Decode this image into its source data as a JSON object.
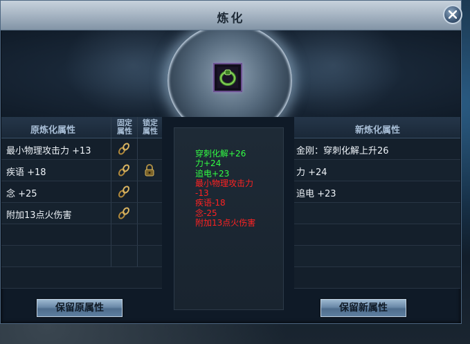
{
  "window": {
    "title": "炼化",
    "close_icon": "close-icon",
    "item_icon": "green-ring-icon"
  },
  "left_panel": {
    "header": "原炼化属性",
    "col_fixed": "固定\n属性",
    "col_fixed_l1": "固定",
    "col_fixed_l2": "属性",
    "col_lock_l1": "锁定",
    "col_lock_l2": "属性",
    "rows": [
      {
        "text": "最小物理攻击力 +13",
        "fixed_icon": "chain-icon",
        "lock_icon": ""
      },
      {
        "text": "疾语 +18",
        "fixed_icon": "chain-icon",
        "lock_icon": "lock-icon"
      },
      {
        "text": "念 +25",
        "fixed_icon": "chain-icon",
        "lock_icon": ""
      },
      {
        "text": "附加13点火伤害",
        "fixed_icon": "chain-icon",
        "lock_icon": ""
      }
    ],
    "button": "保留原属性"
  },
  "middle_panel": {
    "lines": [
      {
        "text": "穿刺化解+26",
        "color": "#33ff44"
      },
      {
        "text": "力+24",
        "color": "#33ff44"
      },
      {
        "text": "追电+23",
        "color": "#33ff44"
      },
      {
        "text": "最小物理攻击力",
        "color": "#ff2222"
      },
      {
        "text": "-13",
        "color": "#ff2222"
      },
      {
        "text": "疾语-18",
        "color": "#ff2222"
      },
      {
        "text": "念-25",
        "color": "#ff2222"
      },
      {
        "text": "附加13点火伤害",
        "color": "#ff2222"
      }
    ]
  },
  "right_panel": {
    "header": "新炼化属性",
    "rows": [
      {
        "text": "金刚：穿刺化解上升26"
      },
      {
        "text": "力 +24"
      },
      {
        "text": "追电 +23"
      }
    ],
    "button": "保留新属性"
  }
}
